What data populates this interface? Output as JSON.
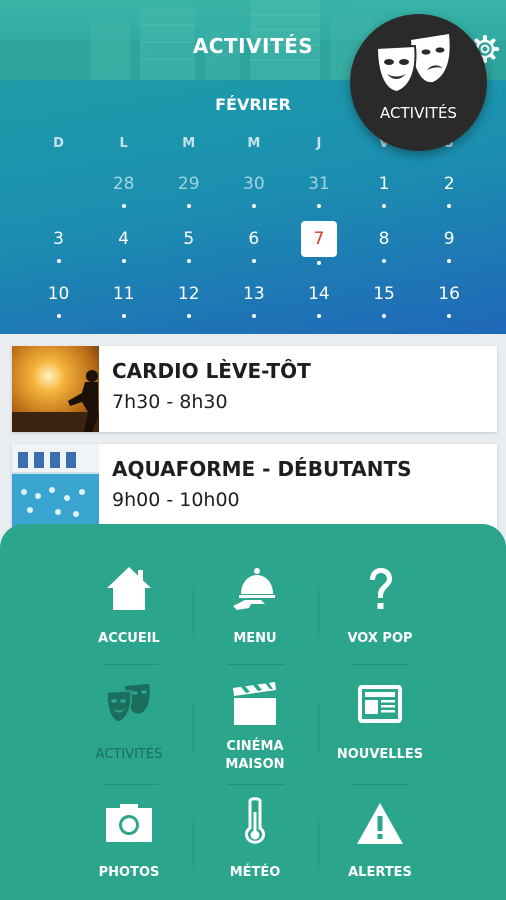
{
  "header": {
    "title": "ACTIVITÉS",
    "settings_icon": "gear-icon"
  },
  "calendar": {
    "month": "FÉVRIER",
    "weekdays": [
      "D",
      "L",
      "M",
      "M",
      "J",
      "V",
      "S"
    ],
    "weeks": [
      [
        "28",
        "29",
        "30",
        "31",
        "1",
        "2"
      ],
      [
        "3",
        "4",
        "5",
        "6",
        "7",
        "8",
        "9"
      ],
      [
        "10",
        "11",
        "12",
        "13",
        "14",
        "15",
        "16"
      ]
    ],
    "selected_day": "7",
    "selected_color": "#e5322d"
  },
  "badge": {
    "label": "ACTIVITÉS",
    "icon": "theater-masks-icon"
  },
  "events": [
    {
      "title": "CARDIO LÈVE-TÔT",
      "time": "7h30 - 8h30",
      "image": "runner-silhouette-sunset"
    },
    {
      "title": "AQUAFORME - DÉBUTANTS",
      "time": "9h00 - 10h00",
      "image": "indoor-pool"
    }
  ],
  "menu": {
    "items": [
      {
        "label": "ACCUEIL",
        "icon": "house-icon"
      },
      {
        "label": "MENU",
        "icon": "serving-cloche-icon"
      },
      {
        "label": "VOX POP",
        "icon": "question-mark-icon"
      },
      {
        "label": "ACTIVITÉS",
        "icon": "theater-masks-icon",
        "active": true
      },
      {
        "label_line1": "CINÉMA",
        "label_line2": "MAISON",
        "icon": "clapperboard-icon"
      },
      {
        "label": "NOUVELLES",
        "icon": "newspaper-icon"
      },
      {
        "label": "PHOTOS",
        "icon": "camera-icon"
      },
      {
        "label": "MÉTÉO",
        "icon": "thermometer-icon"
      },
      {
        "label": "ALERTES",
        "icon": "warning-triangle-icon"
      }
    ],
    "background": "#2ba58c",
    "active_color": "#1b6e5e"
  }
}
